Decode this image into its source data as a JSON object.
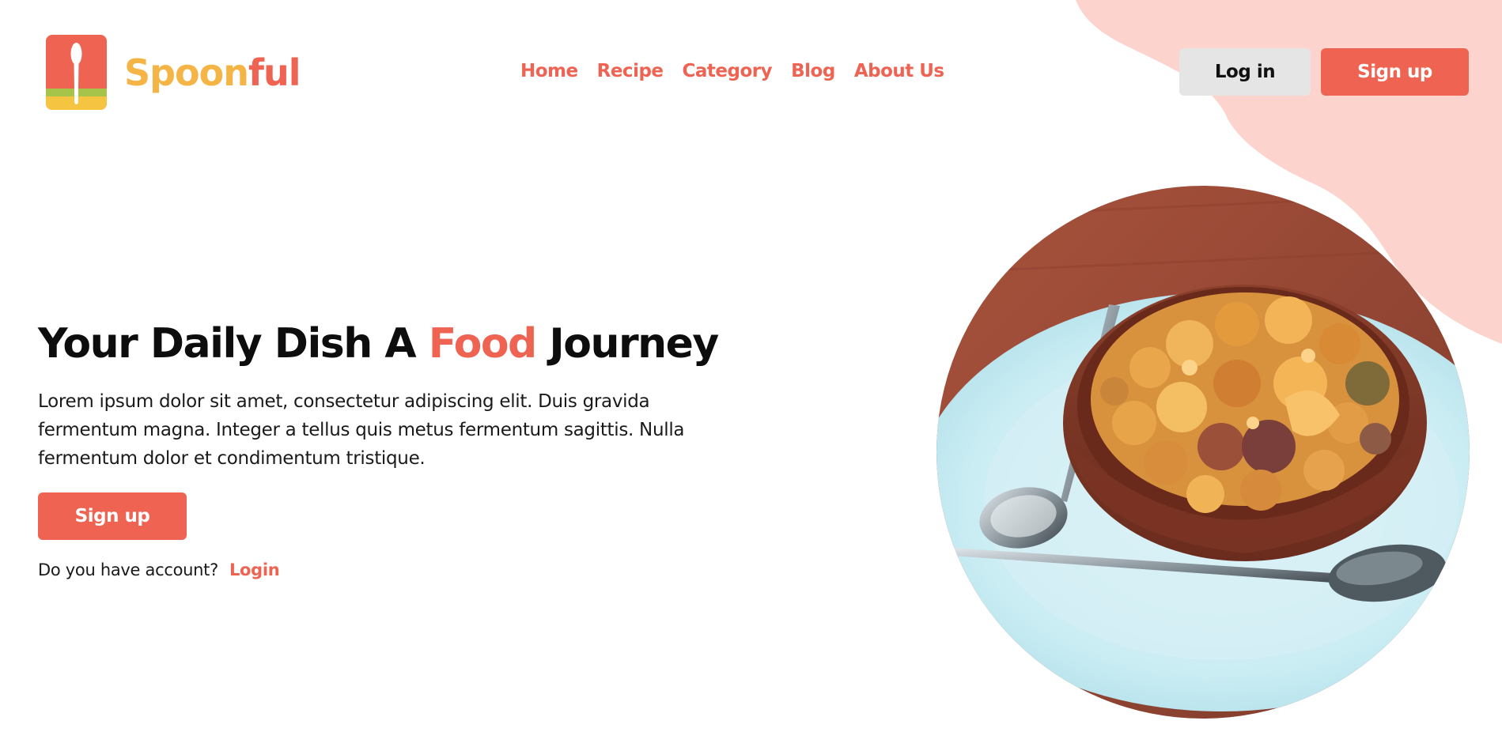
{
  "brand": {
    "name_part1": "Spoon",
    "name_part2": "ful",
    "logo_icon": "spoon-icon"
  },
  "nav": {
    "items": [
      "Home",
      "Recipe",
      "Category",
      "Blog",
      "About Us"
    ]
  },
  "header": {
    "login_label": "Log in",
    "signup_label": "Sign up"
  },
  "hero": {
    "title_before": "Your Daily Dish A ",
    "title_highlight": "Food",
    "title_after": " Journey",
    "description": "Lorem ipsum dolor sit amet, consectetur adipiscing elit. Duis gravida fermentum magna. Integer a tellus quis metus fermentum sagittis. Nulla fermentum dolor et condimentum tristique.",
    "signup_label": "Sign up",
    "account_question": "Do you have account?",
    "login_link": "Login"
  },
  "colors": {
    "accent": "#ee6352",
    "brand_yellow": "#f5b546",
    "blob_pink": "#fcd3cd",
    "login_button_bg": "#e5e5e5"
  }
}
